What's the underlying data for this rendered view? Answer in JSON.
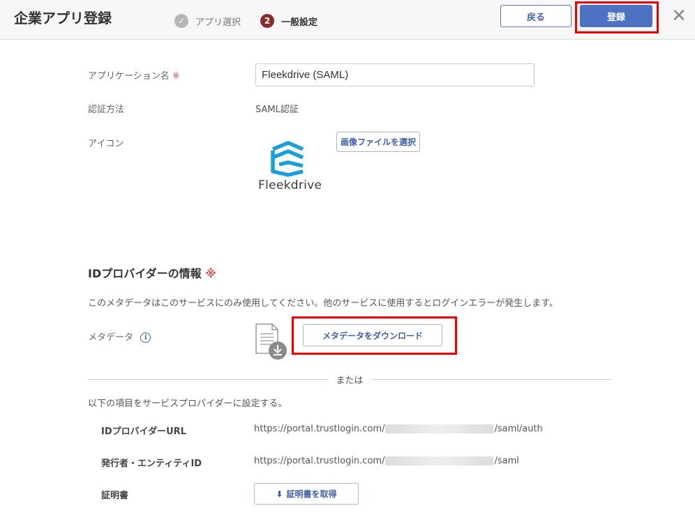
{
  "header": {
    "title": "企業アプリ登録",
    "steps": [
      {
        "icon": "✓",
        "label": "アプリ選択"
      },
      {
        "icon": "2",
        "label": "一般設定"
      }
    ],
    "back_label": "戻る",
    "register_label": "登録",
    "close_glyph": "✕"
  },
  "form": {
    "app_name_label": "アプリケーション名",
    "required_mark": "※",
    "app_name_value": "Fleekdrive (SAML)",
    "auth_label": "認証方法",
    "auth_value": "SAML認証",
    "icon_label": "アイコン",
    "select_image_label": "画像ファイルを選択",
    "logo_text": "Fleekdrive"
  },
  "idp": {
    "title": "IDプロバイダーの情報",
    "required_mark": "※",
    "description": "このメタデータはこのサービスにのみ使用してください。他のサービスに使用するとログインエラーが発生します。",
    "metadata_label": "メタデータ",
    "info_glyph": "i",
    "download_label": "メタデータをダウンロード",
    "or_text": "または",
    "instruction": "以下の項目をサービスプロバイダーに設定する。",
    "url_label": "IDプロバイダーURL",
    "url_prefix": "https://portal.trustlogin.com/",
    "url_suffix": "/saml/auth",
    "issuer_label": "発行者・エンティティID",
    "issuer_prefix": "https://portal.trustlogin.com/",
    "issuer_suffix": "/saml",
    "cert_label": "証明書",
    "cert_button_label": "証明書を取得",
    "cert_button_glyph": "⬇"
  },
  "colors": {
    "accent": "#4d72c4",
    "highlight": "#ee0000",
    "logo": "#1a9fd9"
  }
}
